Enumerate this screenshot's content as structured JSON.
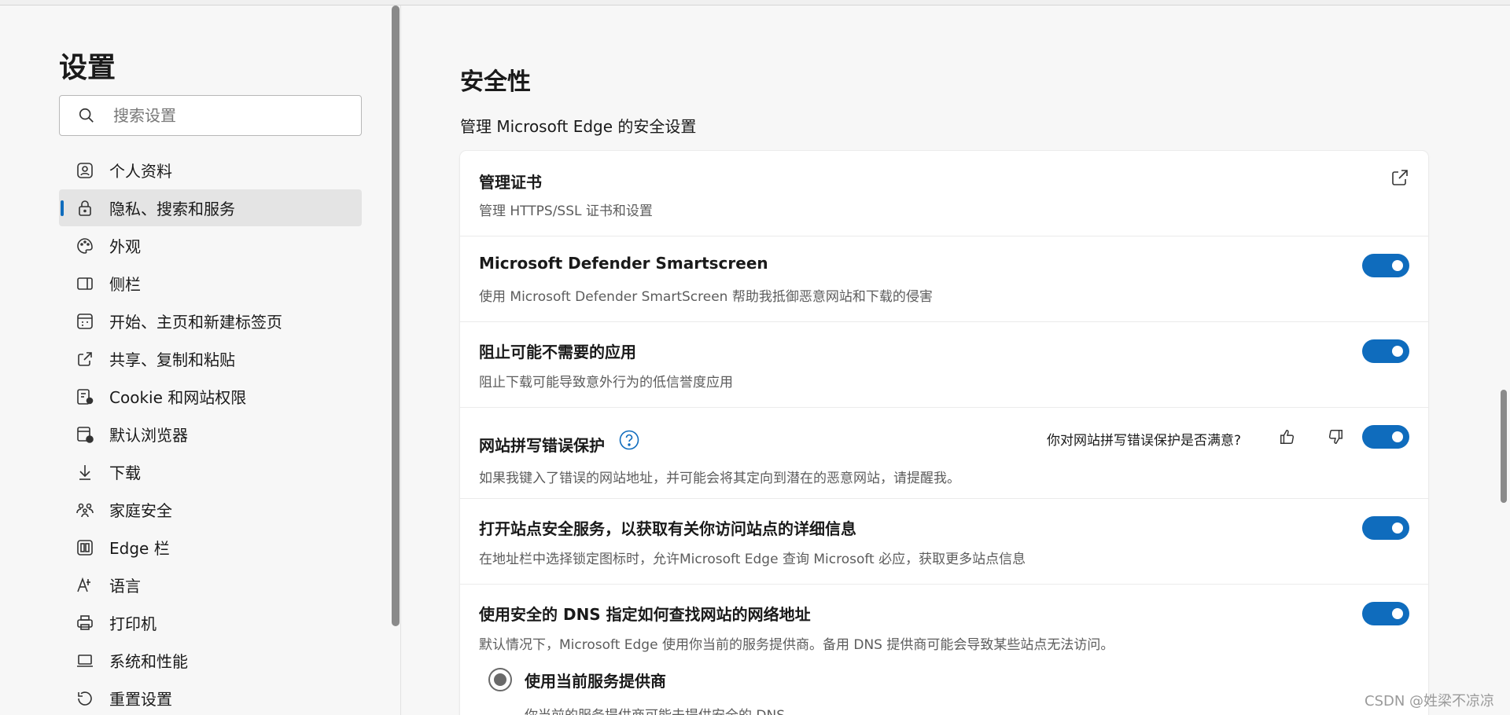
{
  "sidebar": {
    "title": "设置",
    "search_placeholder": "搜索设置",
    "items": [
      {
        "label": "个人资料",
        "icon": "profile-icon"
      },
      {
        "label": "隐私、搜索和服务",
        "icon": "lock-icon",
        "active": true
      },
      {
        "label": "外观",
        "icon": "palette-icon"
      },
      {
        "label": "侧栏",
        "icon": "sidebar-icon"
      },
      {
        "label": "开始、主页和新建标签页",
        "icon": "newtab-icon"
      },
      {
        "label": "共享、复制和粘贴",
        "icon": "share-icon"
      },
      {
        "label": "Cookie 和网站权限",
        "icon": "cookie-icon"
      },
      {
        "label": "默认浏览器",
        "icon": "browser-icon"
      },
      {
        "label": "下载",
        "icon": "download-icon"
      },
      {
        "label": "家庭安全",
        "icon": "family-icon"
      },
      {
        "label": "Edge 栏",
        "icon": "edgebar-icon"
      },
      {
        "label": "语言",
        "icon": "language-icon"
      },
      {
        "label": "打印机",
        "icon": "printer-icon"
      },
      {
        "label": "系统和性能",
        "icon": "laptop-icon"
      },
      {
        "label": "重置设置",
        "icon": "reset-icon"
      }
    ]
  },
  "main": {
    "title": "安全性",
    "subtitle": "管理 Microsoft Edge 的安全设置",
    "rows": [
      {
        "title": "管理证书",
        "desc": "管理 HTTPS/SSL 证书和设置"
      },
      {
        "title": "Microsoft Defender Smartscreen",
        "desc": "使用 Microsoft Defender SmartScreen 帮助我抵御恶意网站和下载的侵害",
        "on": true
      },
      {
        "title": "阻止可能不需要的应用",
        "desc": "阻止下载可能导致意外行为的低信誉度应用",
        "on": true
      },
      {
        "title": "网站拼写错误保护",
        "desc": "如果我键入了错误的网站地址，并可能会将其定向到潜在的恶意网站，请提醒我。",
        "feedback": "你对网站拼写错误保护是否满意?",
        "on": true
      },
      {
        "title": "打开站点安全服务，以获取有关你访问站点的详细信息",
        "desc": "在地址栏中选择锁定图标时，允许Microsoft Edge 查询 Microsoft 必应，获取更多站点信息",
        "on": true
      },
      {
        "title": "使用安全的 DNS 指定如何查找网站的网络地址",
        "desc": "默认情况下，Microsoft Edge 使用你当前的服务提供商。备用 DNS 提供商可能会导致某些站点无法访问。",
        "on": true
      }
    ],
    "radio": {
      "label": "使用当前服务提供商",
      "desc": "你当前的服务提供商可能未提供安全的 DNS"
    }
  },
  "watermark": "CSDN @姓梁不凉凉",
  "colors": {
    "accent": "#0f6cbd"
  }
}
